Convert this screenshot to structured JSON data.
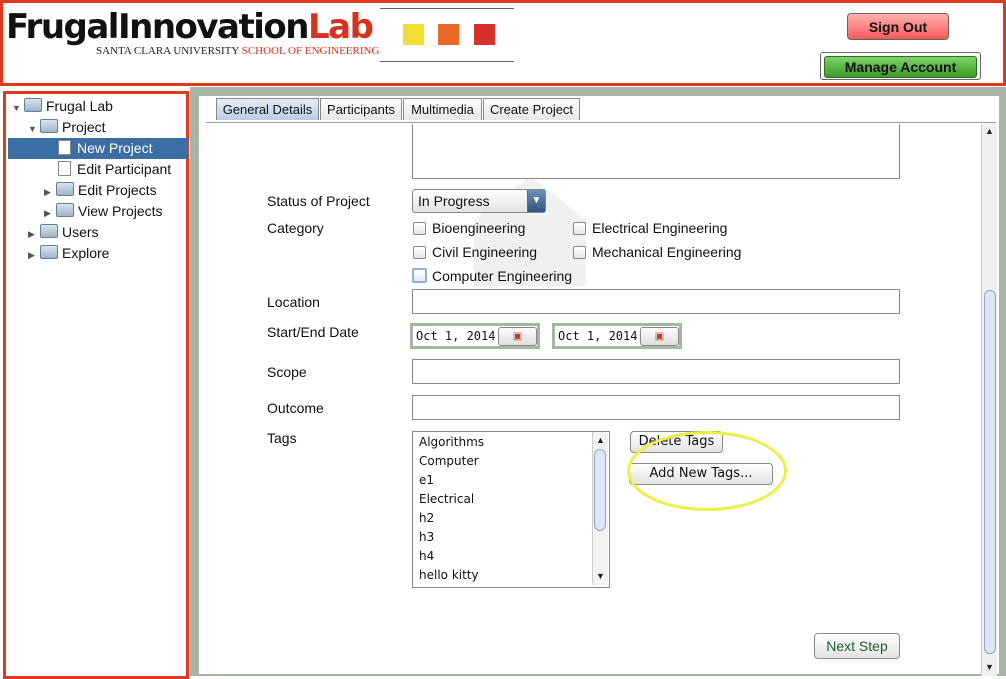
{
  "header": {
    "logo_main": "FrugalInnovation",
    "logo_lab": "Lab",
    "logo_university": "SANTA CLARA UNIVERSITY",
    "logo_school": "SCHOOL OF ENGINEERING",
    "logo_colors": [
      "#f0e031",
      "#ec6826",
      "#d8312c"
    ],
    "sign_out_label": "Sign Out",
    "manage_account_label": "Manage Account"
  },
  "sidebar": {
    "items": [
      {
        "label": "Frugal Lab",
        "type": "folder",
        "expanded": true
      },
      {
        "label": "Project",
        "type": "folder",
        "expanded": true
      },
      {
        "label": "New Project",
        "type": "document",
        "selected": true
      },
      {
        "label": "Edit Participant",
        "type": "document"
      },
      {
        "label": "Edit Projects",
        "type": "folder",
        "expanded": false
      },
      {
        "label": "View Projects",
        "type": "folder",
        "expanded": false
      },
      {
        "label": "Users",
        "type": "folder",
        "expanded": false
      },
      {
        "label": "Explore",
        "type": "folder",
        "expanded": false
      }
    ]
  },
  "tabs": [
    {
      "label": "General Details",
      "active": true
    },
    {
      "label": "Participants"
    },
    {
      "label": "Multimedia"
    },
    {
      "label": "Create Project"
    }
  ],
  "form": {
    "status_label": "Status of Project",
    "status_value": "In Progress",
    "category_label": "Category",
    "categories": [
      {
        "label": "Bioengineering",
        "checked": false
      },
      {
        "label": "Electrical Engineering",
        "checked": false
      },
      {
        "label": "Civil Engineering",
        "checked": false
      },
      {
        "label": "Mechanical Engineering",
        "checked": false
      },
      {
        "label": "Computer Engineering",
        "checked": false
      }
    ],
    "location_label": "Location",
    "location_value": "",
    "dates_label": "Start/End Date",
    "start_date": "Oct 1, 2014",
    "end_date": "Oct 1, 2014",
    "scope_label": "Scope",
    "scope_value": "",
    "outcome_label": "Outcome",
    "outcome_value": "",
    "tags_label": "Tags",
    "tags": [
      "Algorithms",
      "Computer",
      "e1",
      "Electrical",
      "h2",
      "h3",
      "h4",
      "hello kitty"
    ],
    "delete_tags_label": "Delete Tags",
    "add_tags_label": "Add New Tags...",
    "next_step_label": "Next Step"
  },
  "colors": {
    "accent_red": "#e03a1e",
    "selection_blue": "#3a6ea5",
    "highlight_yellow": "#eef141",
    "frame_green": "#a7b5a4"
  }
}
